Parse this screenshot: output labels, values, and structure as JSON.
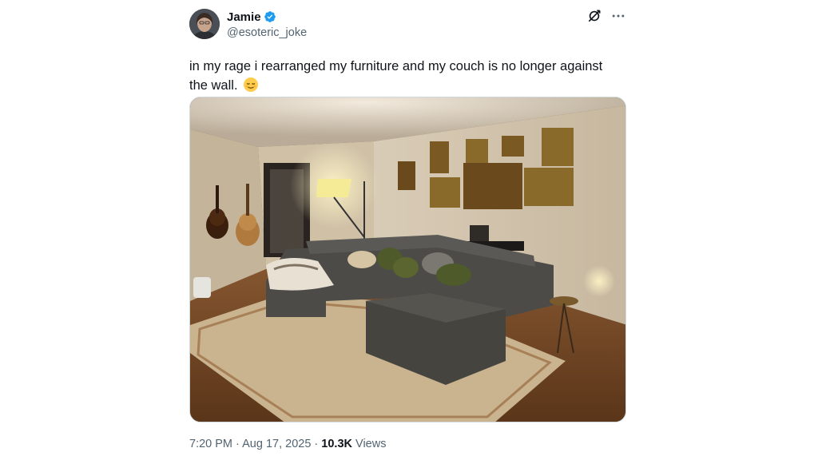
{
  "author": {
    "display_name": "Jamie",
    "handle": "@esoteric_joke",
    "verified": true,
    "avatar_icon": "avatar-photo"
  },
  "header_actions": {
    "grok_icon": "grok-icon",
    "more_icon": "more-icon"
  },
  "tweet": {
    "text": "in my rage i rearranged my furniture and my couch is no longer against the wall.",
    "emoji": "relieved-face-emoji"
  },
  "media": {
    "type": "photo"
  },
  "meta": {
    "time": "7:20 PM",
    "separator": "·",
    "date": "Aug 17, 2025",
    "views_count": "10.3K",
    "views_label": "Views"
  },
  "colors": {
    "text_primary": "#0f1419",
    "text_secondary": "#536471",
    "verified_blue": "#1d9bf0",
    "border": "#cfd9de"
  }
}
